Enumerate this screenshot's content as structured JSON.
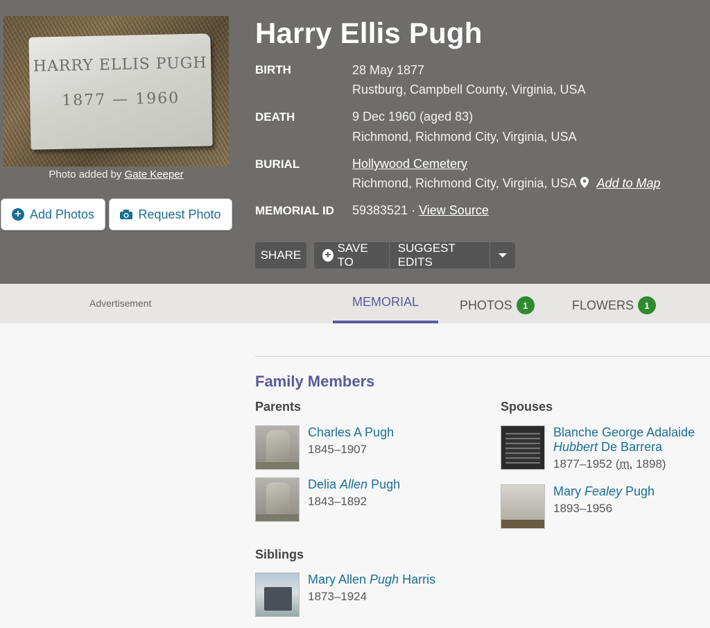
{
  "photo": {
    "stone_name": "HARRY ELLIS PUGH",
    "stone_years": "1877 — 1960",
    "credit_prefix": "Photo added by",
    "credit_user": "Gate Keeper"
  },
  "buttons": {
    "add_photos": "Add Photos",
    "request_photo": "Request Photo"
  },
  "person": {
    "name": "Harry Ellis Pugh",
    "birth_label": "BIRTH",
    "birth_date": "28 May 1877",
    "birth_place": "Rustburg, Campbell County, Virginia, USA",
    "death_label": "DEATH",
    "death_date": "9 Dec 1960 (aged 83)",
    "death_place": "Richmond, Richmond City, Virginia, USA",
    "burial_label": "BURIAL",
    "burial_cemetery": "Hollywood Cemetery",
    "burial_place": "Richmond, Richmond City, Virginia, USA",
    "add_to_map": "Add to Map",
    "memorial_label": "MEMORIAL ID",
    "memorial_id": "59383521 ·",
    "view_source": "View Source"
  },
  "actions": {
    "share": "SHARE",
    "save_to": "SAVE TO",
    "suggest_edits": "SUGGEST EDITS"
  },
  "tabs": {
    "advertisement": "Advertisement",
    "memorial": "MEMORIAL",
    "photos": "PHOTOS",
    "photos_count": "1",
    "flowers": "FLOWERS",
    "flowers_count": "1"
  },
  "family": {
    "title": "Family Members",
    "parents_label": "Parents",
    "spouses_label": "Spouses",
    "siblings_label": "Siblings",
    "parents": [
      {
        "first": "Charles A Pugh",
        "maiden": "",
        "last": "",
        "dates": "1845–1907"
      },
      {
        "first": "Delia ",
        "maiden": "Allen",
        "last": " Pugh",
        "dates": "1843–1892"
      }
    ],
    "spouses": [
      {
        "first": "Blanche George Adalaide ",
        "maiden": "Hubbert",
        "last": " De Barrera",
        "dates": "1877–1952 (",
        "marriage_abbr": "m.",
        "marriage_year": " 1898)"
      },
      {
        "first": "Mary ",
        "maiden": "Fealey",
        "last": " Pugh",
        "dates": "1893–1956"
      }
    ],
    "siblings": [
      {
        "first": "Mary Allen ",
        "maiden": "Pugh",
        "last": " Harris",
        "dates": "1873–1924"
      }
    ]
  },
  "colors": {
    "header_bg": "#6e6d6b",
    "link": "#1a6f93",
    "accent": "#5a5a9a",
    "badge": "#2e8b2e"
  }
}
